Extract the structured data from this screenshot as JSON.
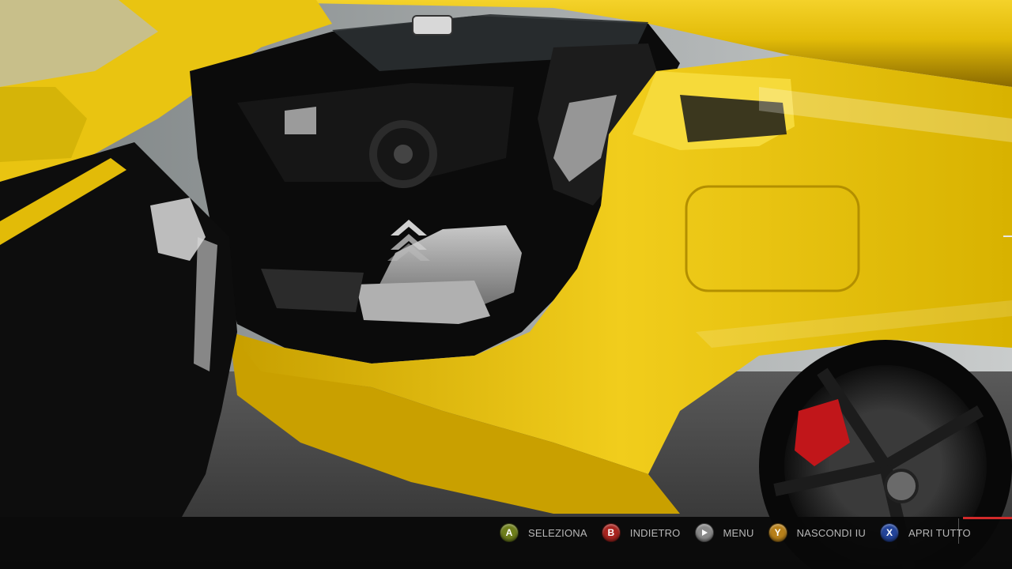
{
  "scene": {
    "description_icon": "car-interior-view",
    "car_color": "#e8c10d",
    "interior_color": "#0b0b0b",
    "seat_color": "#9a9a9a"
  },
  "enter_marker": {
    "icon": "double-chevron-up-icon"
  },
  "hud": {
    "prompts": [
      {
        "button": "A",
        "label": "SELEZIONA",
        "color": "#6f7f1c"
      },
      {
        "button": "B",
        "label": "INDIETRO",
        "color": "#a8241f"
      },
      {
        "button": "",
        "label": "MENU",
        "color": "#8a8a8a",
        "icon": "start-button-icon"
      },
      {
        "button": "Y",
        "label": "NASCONDI IU",
        "color": "#b7801a"
      },
      {
        "button": "X",
        "label": "APRI TUTTO",
        "color": "#23449a"
      }
    ]
  }
}
